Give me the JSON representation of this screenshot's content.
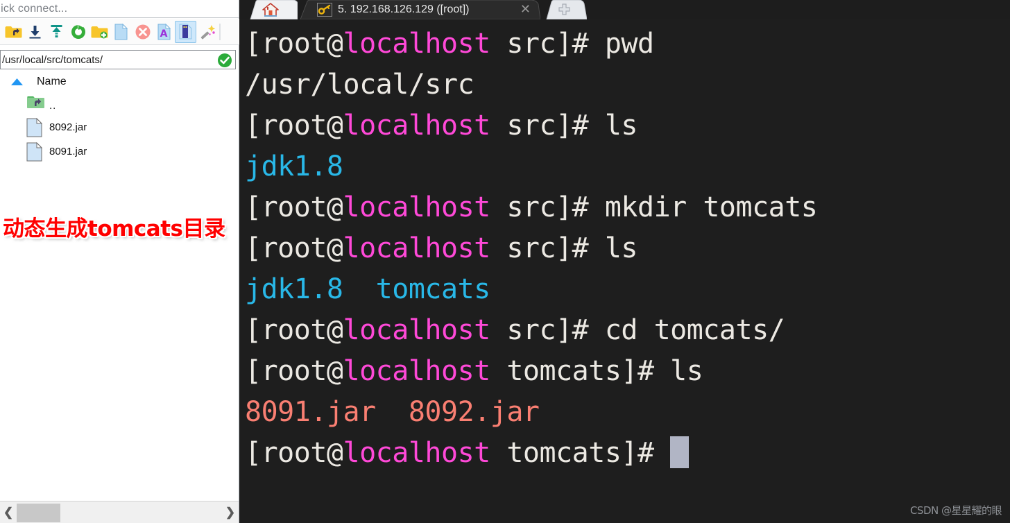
{
  "left_panel": {
    "quick_connect": {
      "text": "uick connect...",
      "full_text": "Quick connect..."
    },
    "toolbar": {
      "buttons": [
        {
          "name": "parent-folder-icon",
          "label": "Go to parent directory"
        },
        {
          "name": "download-icon",
          "label": "Download"
        },
        {
          "name": "upload-icon",
          "label": "Upload"
        },
        {
          "name": "refresh-icon",
          "label": "Refresh"
        },
        {
          "name": "new-folder-icon",
          "label": "New folder"
        },
        {
          "name": "new-file-icon",
          "label": "New file"
        },
        {
          "name": "delete-icon",
          "label": "Delete"
        },
        {
          "name": "rename-icon",
          "label": "Rename"
        },
        {
          "name": "properties-icon",
          "label": "Properties"
        },
        {
          "name": "magic-wand-icon",
          "label": "Tools"
        }
      ]
    },
    "path_bar": {
      "value": "/usr/local/src/tomcats/",
      "confirm_icon": "check-circle-icon"
    },
    "column_header": {
      "sort_arrow": "sort-ascending-icon",
      "name": "Name"
    },
    "files": [
      {
        "icon": "parent-folder-icon",
        "name": ".."
      },
      {
        "icon": "file-icon",
        "name": "8092.jar"
      },
      {
        "icon": "file-icon",
        "name": "8091.jar"
      }
    ],
    "hscroll": {
      "left_arrow": "chevron-left-icon",
      "right_arrow": "chevron-right-icon"
    }
  },
  "annotation": {
    "text": "动态生成tomcats目录",
    "color": "#ff0000"
  },
  "tabs": {
    "home": {
      "icon": "home-icon",
      "label": ""
    },
    "session": {
      "icon": "key-icon",
      "label": "5. 192.168.126.129 ([root])",
      "close_icon": "close-icon",
      "active": true
    },
    "new_tab": {
      "icon": "plus-icon",
      "label": ""
    }
  },
  "terminal": {
    "colors": {
      "background": "#1e1e1e",
      "foreground": "#ece9e3",
      "host": "#ff49d8",
      "directory": "#29b8e8",
      "archive": "#fa7f72",
      "cursor": "#b1b5c5"
    },
    "lines": [
      {
        "segments": [
          {
            "t": "[root@",
            "c": "def"
          },
          {
            "t": "localhost",
            "c": "host"
          },
          {
            "t": " src]# pwd",
            "c": "def"
          }
        ]
      },
      {
        "segments": [
          {
            "t": "/usr/local/src",
            "c": "def"
          }
        ]
      },
      {
        "segments": [
          {
            "t": "[root@",
            "c": "def"
          },
          {
            "t": "localhost",
            "c": "host"
          },
          {
            "t": " src]# ls",
            "c": "def"
          }
        ]
      },
      {
        "segments": [
          {
            "t": "jdk1.8",
            "c": "dir"
          }
        ]
      },
      {
        "segments": [
          {
            "t": "[root@",
            "c": "def"
          },
          {
            "t": "localhost",
            "c": "host"
          },
          {
            "t": " src]# mkdir tomcats",
            "c": "def"
          }
        ]
      },
      {
        "segments": [
          {
            "t": "[root@",
            "c": "def"
          },
          {
            "t": "localhost",
            "c": "host"
          },
          {
            "t": " src]# ls",
            "c": "def"
          }
        ]
      },
      {
        "segments": [
          {
            "t": "jdk1.8  tomcats",
            "c": "dir"
          }
        ]
      },
      {
        "segments": [
          {
            "t": "[root@",
            "c": "def"
          },
          {
            "t": "localhost",
            "c": "host"
          },
          {
            "t": " src]# cd tomcats/",
            "c": "def"
          }
        ]
      },
      {
        "segments": [
          {
            "t": "[root@",
            "c": "def"
          },
          {
            "t": "localhost",
            "c": "host"
          },
          {
            "t": " tomcats]# ls",
            "c": "def"
          }
        ]
      },
      {
        "segments": [
          {
            "t": "8091.jar  8092.jar",
            "c": "arch"
          }
        ]
      },
      {
        "segments": [
          {
            "t": "[root@",
            "c": "def"
          },
          {
            "t": "localhost",
            "c": "host"
          },
          {
            "t": " tomcats]# ",
            "c": "def"
          }
        ],
        "cursor": true
      }
    ]
  },
  "watermark": {
    "text": "CSDN @星星耀的眼"
  }
}
